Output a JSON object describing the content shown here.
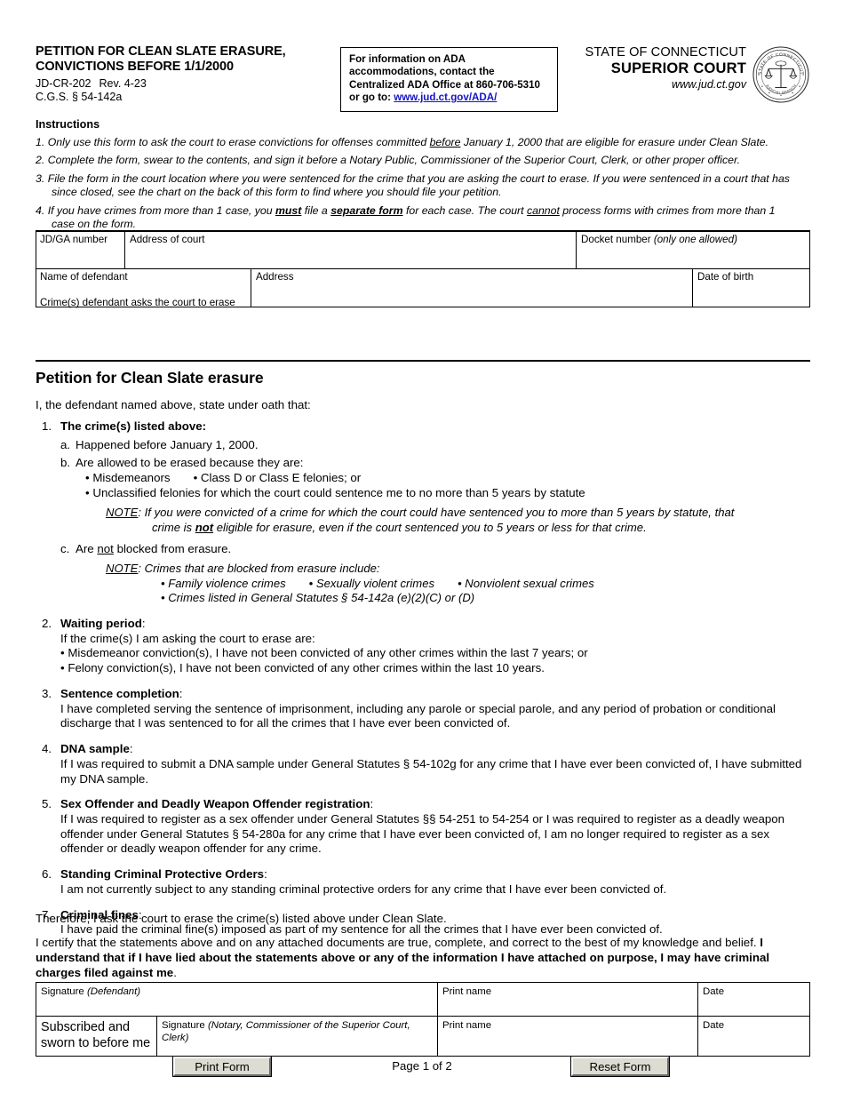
{
  "header": {
    "form_title_line1": "PETITION FOR CLEAN SLATE ERASURE,",
    "form_title_line2": "CONVICTIONS BEFORE 1/1/2000",
    "form_number": "JD-CR-202",
    "revision": "Rev. 4-23",
    "statute_ref": "C.G.S. § 54-142a",
    "ada_line1": "For information on ADA",
    "ada_line2": "accommodations, contact the",
    "ada_line3": "Centralized ADA Office at 860-706-5310",
    "ada_line4_prefix": "or go to: ",
    "ada_link": "www.jud.ct.gov/ADA/",
    "state_line": "STATE OF CONNECTICUT",
    "court_line": "SUPERIOR COURT",
    "website": "www.jud.ct.gov",
    "seal_top_text": "STATE OF CONNECTICUT",
    "seal_bottom_text": "JUDICIAL BRANCH"
  },
  "instructions": {
    "title": "Instructions",
    "items": [
      {
        "marker": "1.",
        "text_a": "Only use this form to ask the court to erase convictions for offenses committed ",
        "underline_1": "before",
        "text_b": " January 1, 2000 that are eligible for erasure under Clean Slate.",
        "cont": ""
      },
      {
        "marker": "2.",
        "text_a": "Complete the form, swear to the contents, and sign it before a Notary Public, Commissioner of the Superior Court, Clerk, or other proper officer.",
        "underline_1": "",
        "text_b": "",
        "cont": ""
      },
      {
        "marker": "3.",
        "text_a": "File the form in the court location where you were sentenced for the crime that you are asking the court to erase. If you were sentenced in a court that has",
        "underline_1": "",
        "text_b": "",
        "cont": "since closed, see the chart on the back of this form to find where you should file your petition."
      },
      {
        "marker": "4.",
        "text_a": "If you have crimes from more than 1 case, you ",
        "underline_1": "must",
        "text_b": " file a ",
        "underline_2": "separate form",
        "text_c": " for each case. The court ",
        "underline_3": "cannot",
        "text_d": " process forms with crimes from more than 1",
        "cont": "case on the form."
      }
    ]
  },
  "form_fields": {
    "jd_ga_number_label": "JD/GA number",
    "address_of_court_label": "Address of court",
    "docket_number_label": "Docket number ",
    "docket_number_note": "(only one allowed)",
    "name_of_defendant_label": "Name of defendant",
    "address_label": "Address",
    "date_of_birth_label": "Date of birth",
    "crimes_label": "Crime(s) defendant asks the court to erase",
    "jd_ga_number_value": "",
    "address_of_court_value": "",
    "docket_number_value": "",
    "name_of_defendant_value": "",
    "address_value": "",
    "date_of_birth_value": "",
    "crimes_value": ""
  },
  "petition": {
    "heading": "Petition for Clean Slate erasure",
    "oath_line": "I, the defendant named above, state under oath that:",
    "items": [
      {
        "marker": "1.",
        "head": "The crime(s) listed above",
        "head_suffix": ":",
        "sub_a_marker": "a.",
        "sub_a_text": "Happened before January 1, 2000.",
        "sub_b_marker": "b.",
        "sub_b_text": "Are allowed to be erased because they are:",
        "bullet_1": "• Misdemeanors",
        "bullet_2": "• Class D or Class E felonies; or",
        "bullet_3": "• Unclassified felonies for which the court could sentence me to no more than 5 years by statute",
        "note_label": "NOTE",
        "note_text_a": ": If you were convicted of a crime for which the court could have sentenced you to more than 5 years by statute, that",
        "note_text_b_pre": "crime is ",
        "note_text_b_bold": "not",
        "note_text_b_post": " eligible for erasure, even if the court sentenced you to 5 years or less for that crime.",
        "sub_c_marker": "c.",
        "sub_c_pre": "Are ",
        "sub_c_underline": "not",
        "sub_c_post": " blocked from erasure.",
        "note2_label": "NOTE",
        "note2_text": ": Crimes that are blocked from erasure include:",
        "note2_bullet_1": "• Family violence crimes",
        "note2_bullet_2": "• Sexually violent crimes",
        "note2_bullet_3": "• Nonviolent sexual crimes",
        "note2_bullet_4": "• Crimes listed in General Statutes § 54-142a (e)(2)(C) or (D)"
      },
      {
        "marker": "2.",
        "head": "Waiting period",
        "head_suffix": ":",
        "line_1": "If the crime(s) I am asking the court to erase are:",
        "line_2": "• Misdemeanor conviction(s), I have not been convicted of any other crimes within the last 7 years; or",
        "line_3": "• Felony conviction(s), I have not been convicted of any other crimes within the last 10 years."
      },
      {
        "marker": "3.",
        "head": "Sentence completion",
        "head_suffix": ":",
        "line_1": "I have completed serving the sentence of imprisonment, including any parole or special parole, and any period of probation or conditional discharge that I was sentenced to for all the crimes that I have ever been convicted of."
      },
      {
        "marker": "4.",
        "head": "DNA sample",
        "head_suffix": ":",
        "line_1": "If I was required to submit a DNA sample under General Statutes § 54-102g for any crime that I have ever been convicted of, I have submitted my DNA sample."
      },
      {
        "marker": "5.",
        "head": "Sex Offender and Deadly Weapon Offender registration",
        "head_suffix": ":",
        "line_1": "If I was required to register as a sex offender under General Statutes §§ 54-251 to 54-254 or I was required to register as a deadly weapon offender under General Statutes § 54-280a for any crime that I have ever been convicted of, I am no longer required to register as a sex offender or deadly weapon offender for any crime."
      },
      {
        "marker": "6.",
        "head": "Standing Criminal Protective Orders",
        "head_suffix": ":",
        "line_1": "I am not currently subject to any standing criminal protective orders for any crime that I have ever been convicted of."
      },
      {
        "marker": "7.",
        "head": "Criminal fines",
        "head_suffix": ":",
        "line_1": "I have paid the criminal fine(s) imposed as part of my sentence for all the crimes that I have ever been convicted of."
      }
    ],
    "therefore": "Therefore, I ask the court to erase the crime(s) listed above under Clean Slate.",
    "certify_plain_1": "I certify that the statements above and on any attached documents are true, complete, and correct to the best of my knowledge and belief. ",
    "certify_bold": "I understand that if I have lied about the statements above or any of the information I have attached on purpose, I may have criminal charges filed against me",
    "certify_plain_2": "."
  },
  "signature_table": {
    "signature_defendant_label": "Signature ",
    "signature_defendant_note": "(Defendant)",
    "print_name_label_1": "Print name",
    "date_label_1": "Date",
    "sworn_line1": "Subscribed and",
    "sworn_line2": "sworn to before me",
    "signature_notary_label": "Signature ",
    "signature_notary_note": "(Notary, Commissioner of the Superior Court, Clerk)",
    "print_name_label_2": "Print name",
    "date_label_2": "Date",
    "signature_defendant_value": "",
    "print_name_value_1": "",
    "date_value_1": "",
    "signature_notary_value": "",
    "print_name_value_2": "",
    "date_value_2": ""
  },
  "footer": {
    "print_button": "Print Form",
    "page_indicator": "Page 1 of 2",
    "reset_button": "Reset Form"
  }
}
